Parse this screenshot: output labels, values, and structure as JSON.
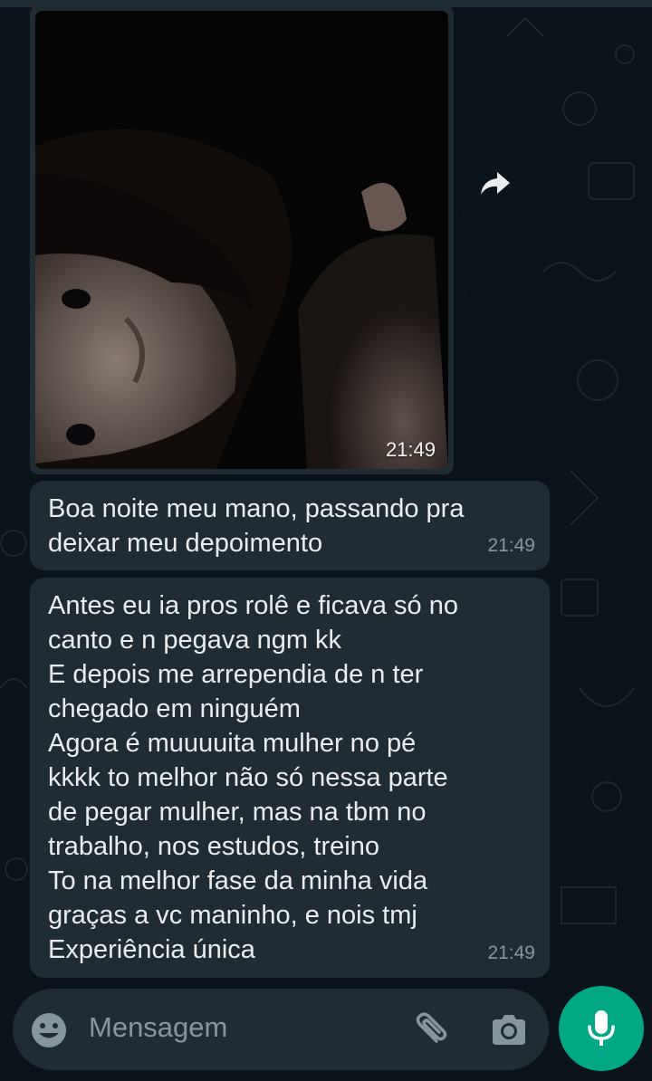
{
  "chat": {
    "media_message": {
      "time": "21:49"
    },
    "messages": [
      {
        "text": "Boa noite meu mano, passando pra\ndeixar meu depoimento",
        "time": "21:49"
      },
      {
        "text": "Antes eu ia pros rolê e ficava só no\ncanto e n pegava ngm kk\nE depois me arrependia de n ter\nchegado em ninguém\nAgora é muuuuita mulher no pé\nkkkk to melhor não só nessa parte\nde pegar mulher, mas na tbm no\ntrabalho, nos estudos, treino\nTo na melhor fase da minha vida\ngraças a vc maninho, e nois tmj\nExperiência única",
        "time": "21:49"
      }
    ]
  },
  "composer": {
    "placeholder": "Mensagem",
    "icons": {
      "emoji": "emoji-icon",
      "attach": "paperclip-icon",
      "camera": "camera-icon",
      "mic": "mic-icon",
      "forward": "forward-icon"
    }
  },
  "colors": {
    "background": "#0b141a",
    "bubble": "#202c33",
    "text": "#e9edef",
    "meta": "#8696a0",
    "accent": "#00a884"
  }
}
